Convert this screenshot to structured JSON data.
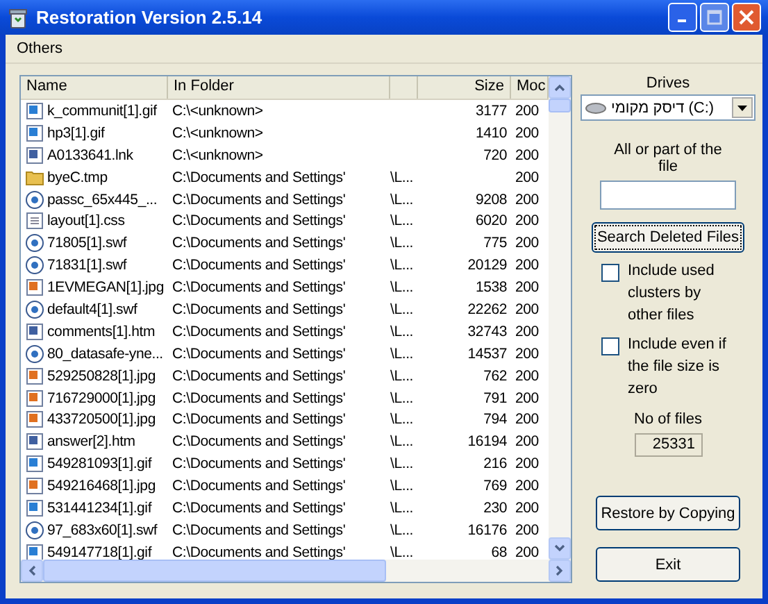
{
  "window": {
    "title": "Restoration Version 2.5.14"
  },
  "menu": [
    "Others"
  ],
  "table": {
    "columns": [
      {
        "label": "Name"
      },
      {
        "label": "In Folder"
      },
      {},
      {
        "label": "Size"
      },
      {
        "label": "Moc"
      }
    ],
    "rows": [
      {
        "kind": "gif",
        "name": "k_communit[1].gif",
        "folder": "C:\\<unknown>",
        "size": "3177",
        "modified": "200"
      },
      {
        "kind": "gif",
        "name": "hp3[1].gif",
        "folder": "C:\\<unknown>",
        "size": "1410",
        "modified": "200"
      },
      {
        "kind": "lnk",
        "name": "A0133641.lnk",
        "folder": "C:\\<unknown>",
        "size": "720",
        "modified": "200"
      },
      {
        "kind": "folder",
        "name": "byeC.tmp",
        "folder": "C:\\Documents and Settings'",
        "folder_tail": "\\L...",
        "modified": "200"
      },
      {
        "kind": "swf",
        "name": "passc_65x445_...",
        "folder": "C:\\Documents and Settings'",
        "folder_tail": "\\L...",
        "size": "9208",
        "modified": "200"
      },
      {
        "kind": "css",
        "name": "layout[1].css",
        "folder": "C:\\Documents and Settings'",
        "folder_tail": "\\L...",
        "size": "6020",
        "modified": "200"
      },
      {
        "kind": "swf",
        "name": "71805[1].swf",
        "folder": "C:\\Documents and Settings'",
        "folder_tail": "\\L...",
        "size": "775",
        "modified": "200"
      },
      {
        "kind": "swf",
        "name": "71831[1].swf",
        "folder": "C:\\Documents and Settings'",
        "folder_tail": "\\L...",
        "size": "20129",
        "modified": "200"
      },
      {
        "kind": "jpg",
        "name": "1EVMEGAN[1].jpg",
        "folder": "C:\\Documents and Settings'",
        "folder_tail": "\\L...",
        "size": "1538",
        "modified": "200"
      },
      {
        "kind": "swf",
        "name": "default4[1].swf",
        "folder": "C:\\Documents and Settings'",
        "folder_tail": "\\L...",
        "size": "22262",
        "modified": "200"
      },
      {
        "kind": "htm",
        "name": "comments[1].htm",
        "folder": "C:\\Documents and Settings'",
        "folder_tail": "\\L...",
        "size": "32743",
        "modified": "200"
      },
      {
        "kind": "swf",
        "name": "80_datasafe-yne...",
        "folder": "C:\\Documents and Settings'",
        "folder_tail": "\\L...",
        "size": "14537",
        "modified": "200"
      },
      {
        "kind": "jpg",
        "name": "529250828[1].jpg",
        "folder": "C:\\Documents and Settings'",
        "folder_tail": "\\L...",
        "size": "762",
        "modified": "200"
      },
      {
        "kind": "jpg",
        "name": "716729000[1].jpg",
        "folder": "C:\\Documents and Settings'",
        "folder_tail": "\\L...",
        "size": "791",
        "modified": "200"
      },
      {
        "kind": "jpg",
        "name": "433720500[1].jpg",
        "folder": "C:\\Documents and Settings'",
        "folder_tail": "\\L...",
        "size": "794",
        "modified": "200"
      },
      {
        "kind": "htm",
        "name": "answer[2].htm",
        "folder": "C:\\Documents and Settings'",
        "folder_tail": "\\L...",
        "size": "16194",
        "modified": "200"
      },
      {
        "kind": "gif",
        "name": "549281093[1].gif",
        "folder": "C:\\Documents and Settings'",
        "folder_tail": "\\L...",
        "size": "216",
        "modified": "200"
      },
      {
        "kind": "jpg",
        "name": "549216468[1].jpg",
        "folder": "C:\\Documents and Settings'",
        "folder_tail": "\\L...",
        "size": "769",
        "modified": "200"
      },
      {
        "kind": "gif",
        "name": "531441234[1].gif",
        "folder": "C:\\Documents and Settings'",
        "folder_tail": "\\L...",
        "size": "230",
        "modified": "200"
      },
      {
        "kind": "swf",
        "name": "97_683x60[1].swf",
        "folder": "C:\\Documents and Settings'",
        "folder_tail": "\\L...",
        "size": "16176",
        "modified": "200"
      },
      {
        "kind": "gif",
        "name": "549147718[1].gif",
        "folder": "C:\\Documents and Settings'",
        "folder_tail": "\\L...",
        "size": "68",
        "modified": "200"
      }
    ]
  },
  "panel": {
    "drives_label": "Drives",
    "drive": "דיסק מקומי (C:)",
    "search_label": "All or part of the file",
    "search_button": "Search Deleted Files",
    "options": [
      {
        "label": "Include used clusters by other files",
        "checked": false
      },
      {
        "label": "Include even if the file size is zero",
        "checked": false
      }
    ],
    "count_label": "No of files",
    "count": "25331",
    "restore_button": "Restore by Copying",
    "exit_button": "Exit"
  }
}
